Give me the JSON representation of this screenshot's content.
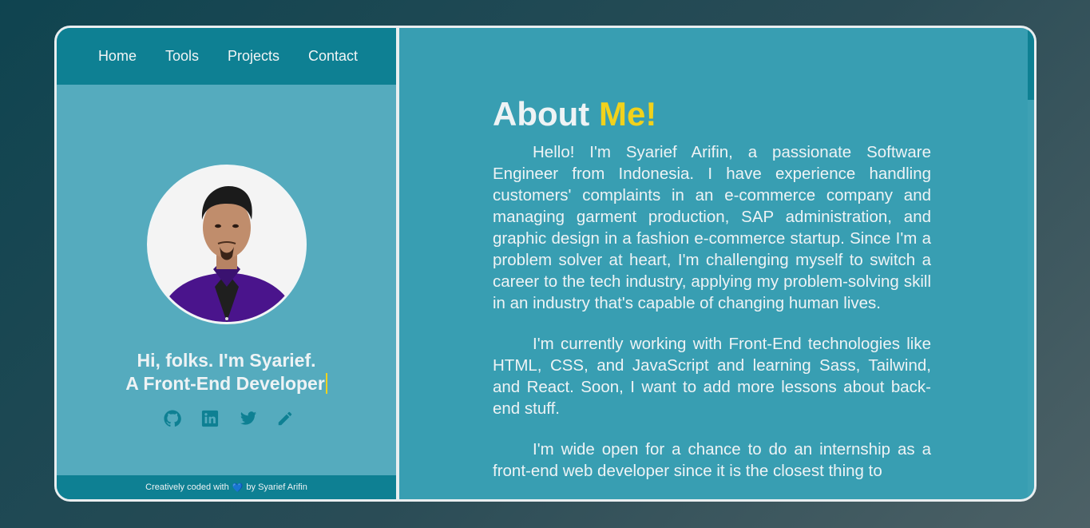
{
  "nav": {
    "items": [
      {
        "label": "Home"
      },
      {
        "label": "Tools"
      },
      {
        "label": "Projects"
      },
      {
        "label": "Contact"
      }
    ]
  },
  "hero": {
    "line1": "Hi, folks. I'm Syarief.",
    "line2": "A Front-End Developer"
  },
  "social": [
    "github-icon",
    "linkedin-icon",
    "twitter-icon",
    "pencil-icon"
  ],
  "footer": {
    "prefix": "Creatively coded with",
    "heart": "💙",
    "suffix": "by Syarief Arifin"
  },
  "about": {
    "title_main": "About",
    "title_highlight": "Me!",
    "paragraphs": [
      "Hello! I'm Syarief Arifin, a passionate Software Engineer from Indonesia. I have experience handling customers' complaints in an e-commerce company and managing garment production, SAP administration, and graphic design in a fashion e-commerce startup. Since I'm a problem solver at heart, I'm challenging myself to switch a career to the tech industry, applying my problem-solving skill in an industry that's capable of changing human lives.",
      "I'm currently working with Front-End technologies like HTML, CSS, and JavaScript and learning Sass, Tailwind, and React. Soon, I want to add more lessons about back-end stuff.",
      "I'm wide open for a chance to do an internship as a front-end web developer since it is the closest thing to"
    ]
  },
  "colors": {
    "accent": "#f1d21c",
    "nav_bg": "#0e8093",
    "left_bg": "#55abbe",
    "right_bg": "#389eb2",
    "icon": "#0e8093"
  }
}
